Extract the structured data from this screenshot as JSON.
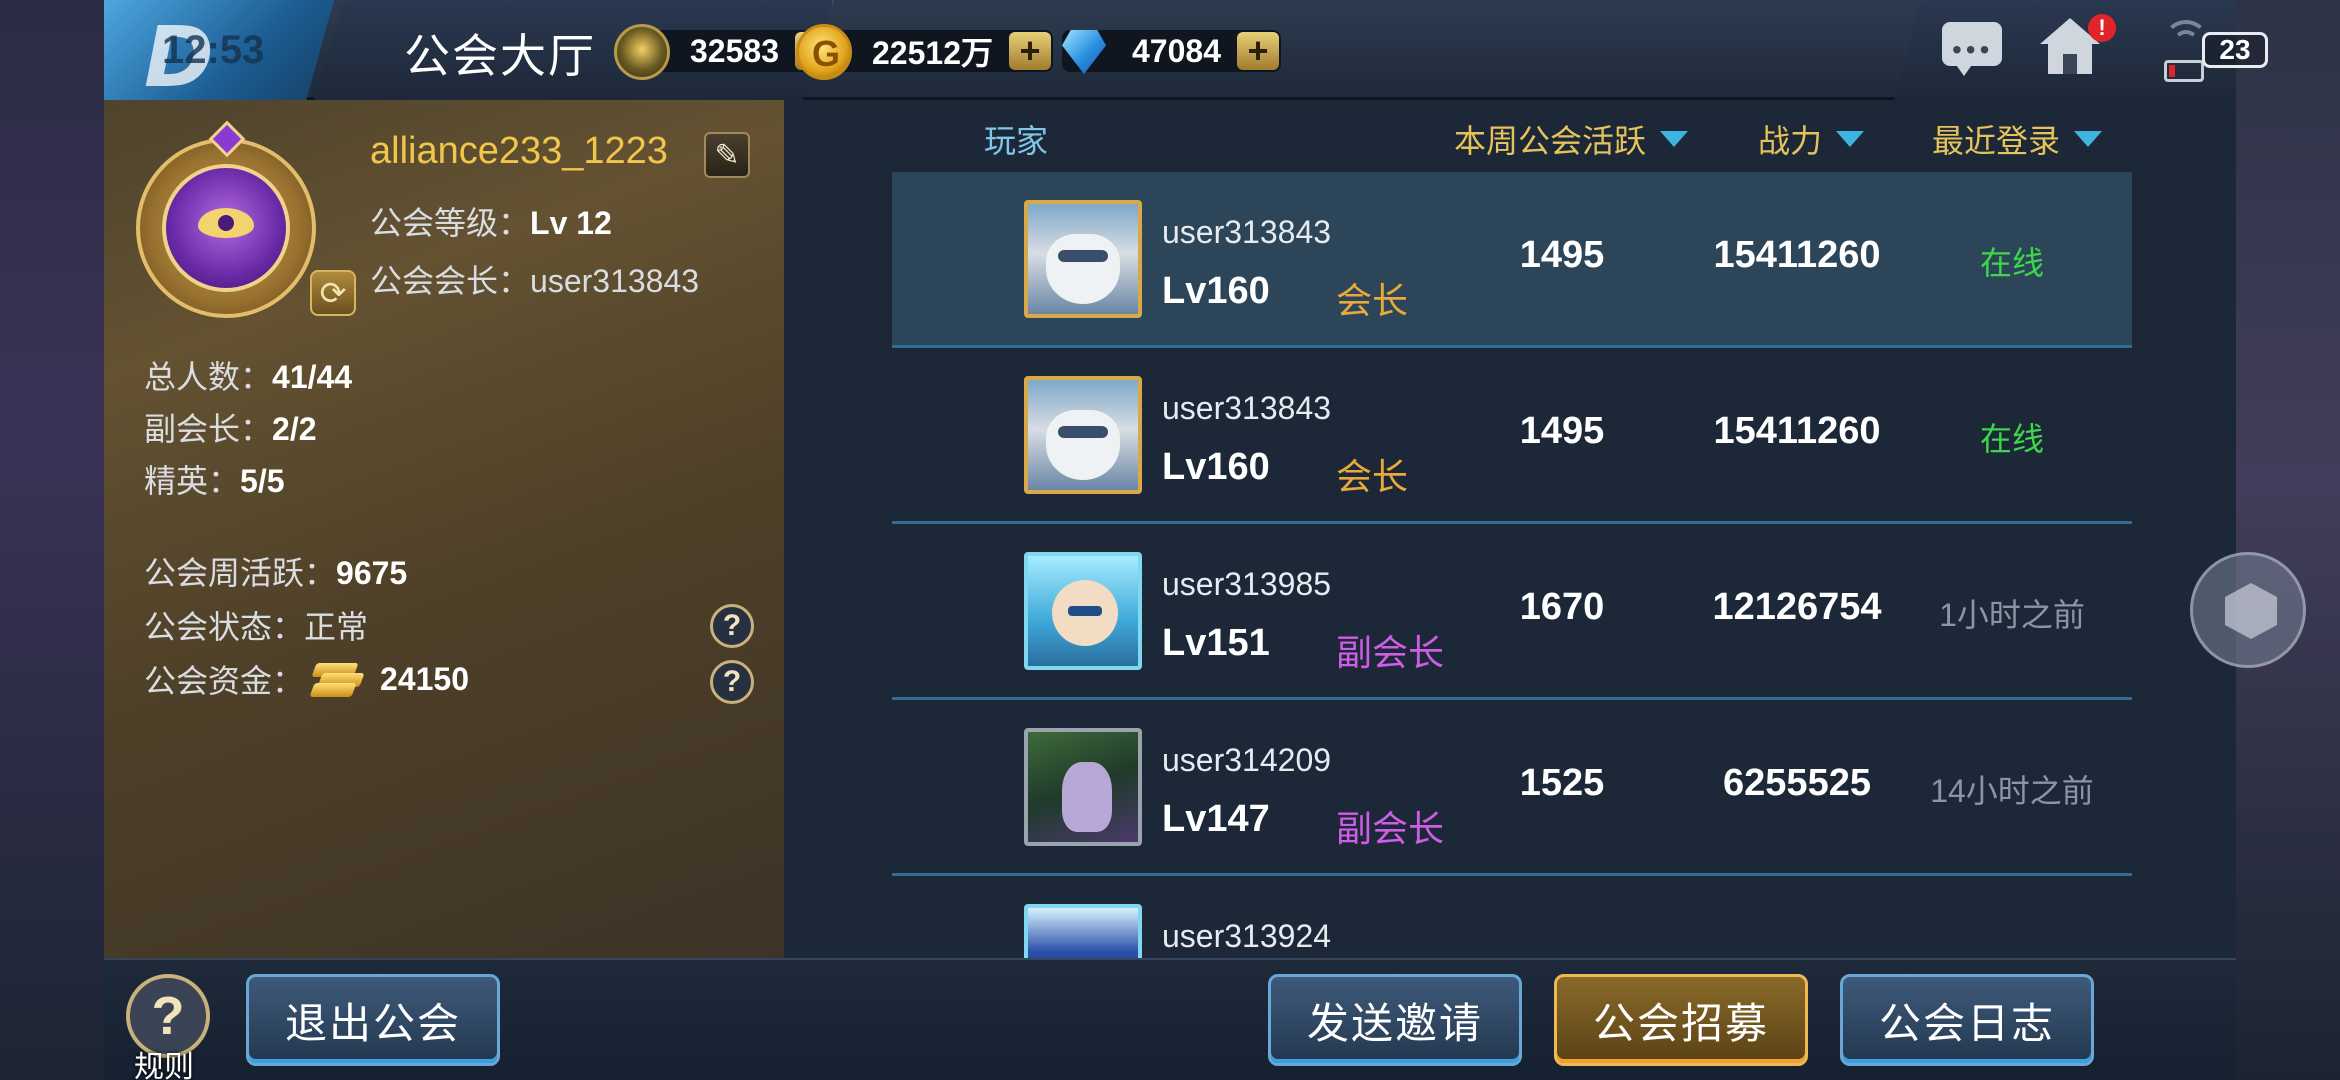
{
  "topbar": {
    "clock": "12:53",
    "title": "公会大厅",
    "currencies": [
      {
        "name": "guild-token",
        "value": "32583",
        "icon": "guild-token-icon"
      },
      {
        "name": "gold",
        "value": "22512万",
        "icon": "gold-coin-icon"
      },
      {
        "name": "diamond",
        "value": "47084",
        "icon": "diamond-icon"
      }
    ],
    "plus_label": "+",
    "alert_badge": "!",
    "battery": "23"
  },
  "guild": {
    "name": "alliance233_1223",
    "level_label": "公会等级：",
    "level_value": "Lv 12",
    "leader_label": "公会会长：",
    "leader_value": "user313843",
    "total_label": "总人数：",
    "total_value": "41/44",
    "vice_label": "副会长：",
    "vice_value": "2/2",
    "elite_label": "精英：",
    "elite_value": "5/5",
    "weekly_label": "公会周活跃：",
    "weekly_value": "9675",
    "status_label": "公会状态：",
    "status_value": "正常",
    "funds_label": "公会资金：",
    "funds_value": "24150",
    "help_label": "?"
  },
  "columns": {
    "player": "玩家",
    "activity": "本周公会活跃",
    "power": "战力",
    "login": "最近登录"
  },
  "members": [
    {
      "name": "user313843",
      "level": "Lv160",
      "role": "会长",
      "role_type": "leader",
      "activity": "1495",
      "power": "15411260",
      "login": "在线",
      "online": true,
      "avatar": "zeus",
      "selected": true
    },
    {
      "name": "user313843",
      "level": "Lv160",
      "role": "会长",
      "role_type": "leader",
      "activity": "1495",
      "power": "15411260",
      "login": "在线",
      "online": true,
      "avatar": "zeus",
      "selected": false
    },
    {
      "name": "user313985",
      "level": "Lv151",
      "role": "副会长",
      "role_type": "vice",
      "activity": "1670",
      "power": "12126754",
      "login": "1小时之前",
      "online": false,
      "avatar": "ice",
      "selected": false
    },
    {
      "name": "user314209",
      "level": "Lv147",
      "role": "副会长",
      "role_type": "vice",
      "activity": "1525",
      "power": "6255525",
      "login": "14小时之前",
      "online": false,
      "avatar": "dark",
      "selected": false
    },
    {
      "name": "user313924",
      "level": "",
      "role": "",
      "role_type": "",
      "activity": "",
      "power": "",
      "login": "",
      "online": false,
      "avatar": "blue",
      "selected": false
    }
  ],
  "bottom": {
    "rules_icon": "?",
    "rules_label": "规则",
    "leave": "退出公会",
    "invite": "发送邀请",
    "recruit": "公会招募",
    "log": "公会日志"
  },
  "colors": {
    "accent_gold": "#e6c35a",
    "online_green": "#3ed64a",
    "leader_orange": "#e9a93c",
    "vice_purple": "#d05ce8",
    "divider_blue": "#2d6f94"
  }
}
